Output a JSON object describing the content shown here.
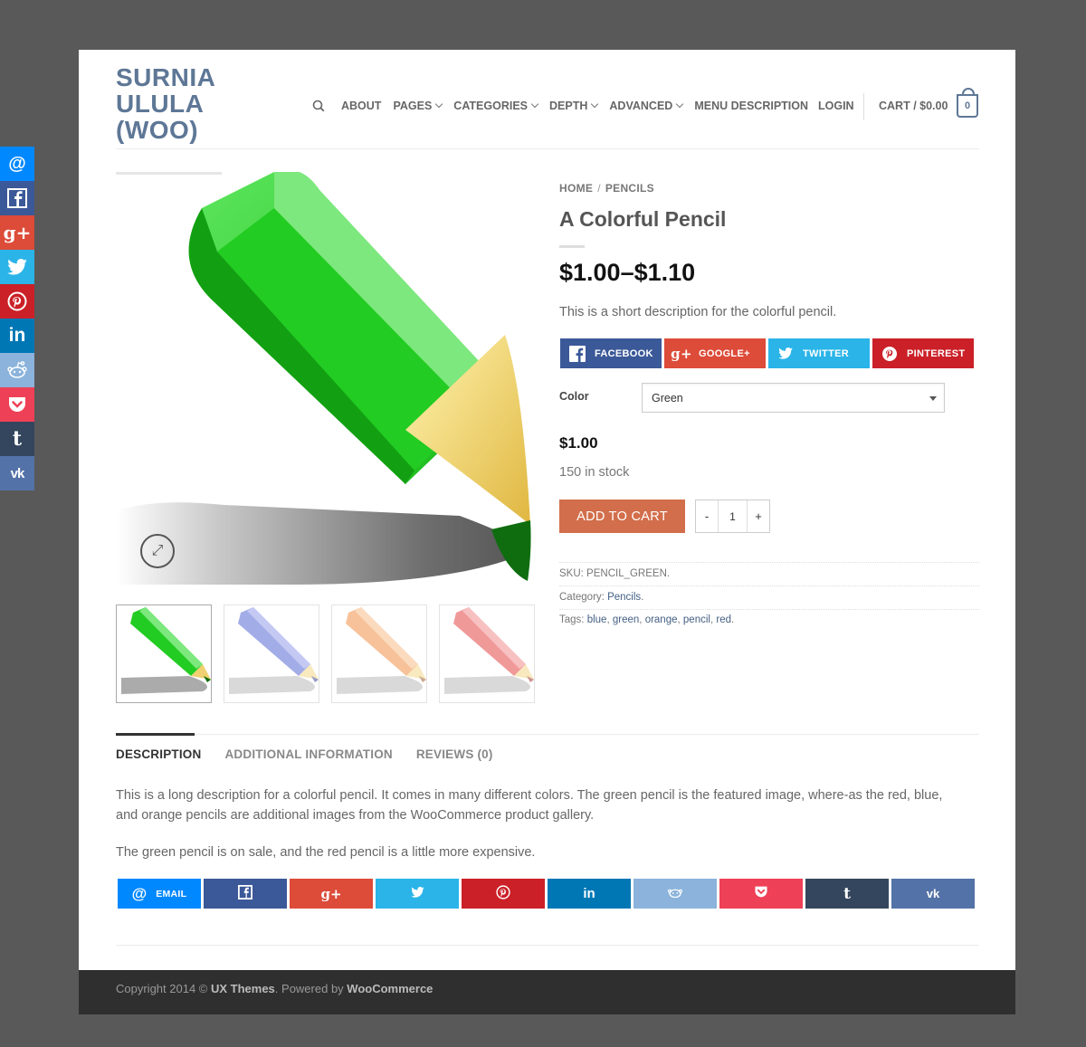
{
  "colors": {
    "accent": "#d26e4b",
    "brand": "#5e7796",
    "link": "#446084",
    "email": "#0088ff",
    "facebook": "#3b5998",
    "google": "#dd4b39",
    "twitter": "#2ab4e8",
    "pinterest": "#cb2027",
    "linkedin": "#0077b5",
    "reddit": "#8bb3db",
    "pocket": "#ee4056",
    "tumblr": "#34465d",
    "vk": "#5372a7"
  },
  "floating_share": [
    "email-icon",
    "facebook-icon",
    "google-plus-icon",
    "twitter-icon",
    "pinterest-icon",
    "linkedin-icon",
    "reddit-icon",
    "pocket-icon",
    "tumblr-icon",
    "vk-icon"
  ],
  "header": {
    "logo_line1": "SURNIA",
    "logo_line2": "ULULA",
    "logo_line3": "(WOO)",
    "nav": {
      "about": "ABOUT",
      "pages": "PAGES",
      "categories": "CATEGORIES",
      "depth": "DEPTH",
      "advanced": "ADVANCED",
      "menu_description": "MENU DESCRIPTION"
    },
    "login": "LOGIN",
    "cart": "CART / $0.00",
    "cart_count": "0"
  },
  "product": {
    "breadcrumb": {
      "home": "HOME",
      "sep": "/",
      "category": "PENCILS"
    },
    "title": "A Colorful Pencil",
    "price_range": "$1.00–$1.10",
    "short_description": "This is a short description for the colorful pencil.",
    "share": {
      "facebook": "FACEBOOK",
      "google": "GOOGLE+",
      "twitter": "TWITTER",
      "pinterest": "PINTEREST"
    },
    "color_label": "Color",
    "color_value": "Green",
    "variation_price": "$1.00",
    "stock": "150 in stock",
    "add_to_cart": "ADD TO CART",
    "qty_minus": "-",
    "qty_value": "1",
    "qty_plus": "+",
    "sku_label": "SKU:",
    "sku": "PENCIL_GREEN.",
    "category_label": "Category:",
    "category": "Pencils",
    "category_after": ".",
    "tags_label": "Tags:",
    "tags": [
      "blue",
      "green",
      "orange",
      "pencil",
      "red"
    ],
    "tags_sep": ",",
    "tags_end": "."
  },
  "gallery": {
    "thumbs": [
      "green",
      "blue",
      "orange",
      "red"
    ]
  },
  "tabs": {
    "description": "DESCRIPTION",
    "additional": "ADDITIONAL INFORMATION",
    "reviews": "REVIEWS (0)"
  },
  "description": {
    "p1": "This is a long description for a colorful pencil. It comes in many different colors. The green pencil is the featured image, where-as the red, blue, and orange pencils are additional images from the WooCommerce product gallery.",
    "p2": "The green pencil is on sale, and the red pencil is a little more expensive."
  },
  "bottom_share": {
    "email": "EMAIL"
  },
  "footer": {
    "prefix": "Copyright 2014 ©",
    "ux": "UX Themes",
    "middle": ". Powered by",
    "woo": "WooCommerce"
  }
}
